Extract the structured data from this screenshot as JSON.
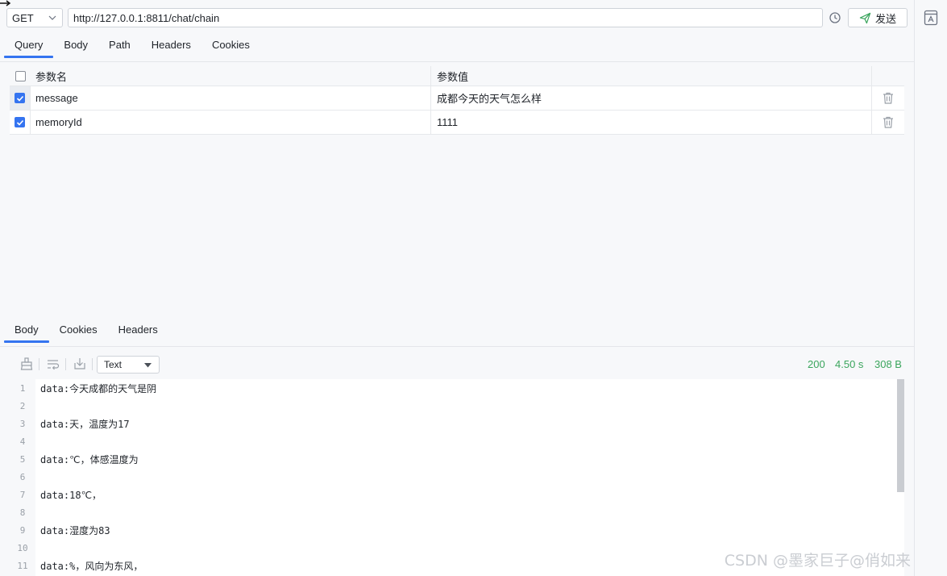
{
  "request": {
    "method": "GET",
    "url": "http://127.0.0.1:8811/chat/chain",
    "send_label": "发送"
  },
  "request_tabs": [
    "Query",
    "Body",
    "Path",
    "Headers",
    "Cookies"
  ],
  "params": {
    "headers": {
      "name": "参数名",
      "value": "参数值"
    },
    "rows": [
      {
        "name": "message",
        "value": "成都今天的天气怎么样",
        "checked": true
      },
      {
        "name": "memoryId",
        "value": "1111",
        "checked": true
      }
    ]
  },
  "response_tabs": [
    "Body",
    "Cookies",
    "Headers"
  ],
  "response": {
    "format": "Text",
    "status": "200",
    "time": "4.50 s",
    "size": "308 B",
    "lines": [
      {
        "n": "1",
        "text": "data:今天成都的天气是阴"
      },
      {
        "n": "2",
        "text": ""
      },
      {
        "n": "3",
        "text": "data:天，温度为17"
      },
      {
        "n": "4",
        "text": ""
      },
      {
        "n": "5",
        "text": "data:℃，体感温度为"
      },
      {
        "n": "6",
        "text": ""
      },
      {
        "n": "7",
        "text": "data:18℃，"
      },
      {
        "n": "8",
        "text": ""
      },
      {
        "n": "9",
        "text": "data:湿度为83"
      },
      {
        "n": "10",
        "text": ""
      },
      {
        "n": "11",
        "text": "data:%，风向为东风，"
      }
    ]
  },
  "watermark": "CSDN @墨家巨子@俏如来",
  "colors": {
    "accent": "#3574f0",
    "status_ok": "#3ba55d"
  },
  "icons": [
    "history-icon",
    "send-icon",
    "trash-icon",
    "sidebar-panel-icon",
    "clear-icon",
    "wrap-icon",
    "download-icon"
  ]
}
